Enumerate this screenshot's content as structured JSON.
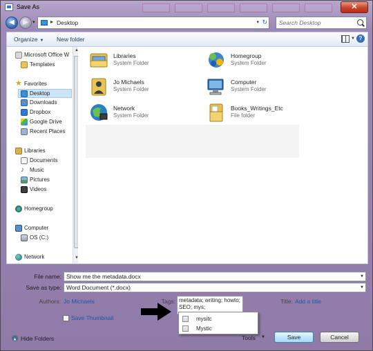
{
  "window": {
    "title": "Save As",
    "close_glyph": "✕"
  },
  "nav": {
    "back_glyph": "◀",
    "forward_glyph": "▶",
    "address_sep": "▸",
    "address": "Desktop",
    "address_caret": "▾",
    "refresh_glyph": "↻",
    "search_placeholder": "Search Desktop"
  },
  "toolbar": {
    "organize": "Organize",
    "organize_caret": "▼",
    "new_folder": "New folder",
    "help": "?"
  },
  "sidebar": {
    "items": [
      {
        "label": "Microsoft Office W",
        "icon": "office-icon"
      },
      {
        "label": "Templates",
        "icon": "folder-icon"
      },
      {
        "label": "Favorites",
        "icon": "star-icon"
      },
      {
        "label": "Desktop",
        "icon": "desktop-icon"
      },
      {
        "label": "Downloads",
        "icon": "downloads-icon"
      },
      {
        "label": "Dropbox",
        "icon": "dropbox-icon"
      },
      {
        "label": "Google Drive",
        "icon": "google-drive-icon"
      },
      {
        "label": "Recent Places",
        "icon": "recent-places-icon"
      },
      {
        "label": "Libraries",
        "icon": "libraries-icon"
      },
      {
        "label": "Documents",
        "icon": "documents-icon"
      },
      {
        "label": "Music",
        "icon": "music-icon"
      },
      {
        "label": "Pictures",
        "icon": "pictures-icon"
      },
      {
        "label": "Videos",
        "icon": "videos-icon"
      },
      {
        "label": "Homegroup",
        "icon": "homegroup-icon"
      },
      {
        "label": "Computer",
        "icon": "computer-icon"
      },
      {
        "label": "OS (C:)",
        "icon": "drive-icon"
      },
      {
        "label": "Network",
        "icon": "network-icon"
      }
    ]
  },
  "files": [
    {
      "name": "Libraries",
      "type": "System Folder",
      "icon": "libraries-icon"
    },
    {
      "name": "Homegroup",
      "type": "System Folder",
      "icon": "homegroup-icon"
    },
    {
      "name": "Jo Michaels",
      "type": "System Folder",
      "icon": "user-folder-icon"
    },
    {
      "name": "Computer",
      "type": "System Folder",
      "icon": "computer-icon"
    },
    {
      "name": "Network",
      "type": "System Folder",
      "icon": "network-icon"
    },
    {
      "name": "Books_Writings_Etc",
      "type": "File folder",
      "icon": "folder-icon"
    }
  ],
  "form": {
    "file_name_label": "File name:",
    "file_name": "Show me the metadata.docx",
    "save_as_type_label": "Save as type:",
    "save_as_type": "Word Document (*.docx)",
    "authors_label": "Authors:",
    "authors": "Jo Michaels",
    "tags_label": "Tags:",
    "tags_value": "metadata; writing; howto; SEO; mys;",
    "title_label": "Title:",
    "title_placeholder": "Add a title",
    "save_thumbnail": "Save Thumbnail",
    "tag_suggestions": [
      "mysitc",
      "Mystic"
    ],
    "hide_folders": "Hide Folders",
    "tools": "Tools",
    "save": "Save",
    "cancel": "Cancel"
  },
  "colors": {
    "accent": "#1d58a6",
    "selection": "#cce4f7",
    "titlebar": "#9c88b6"
  }
}
